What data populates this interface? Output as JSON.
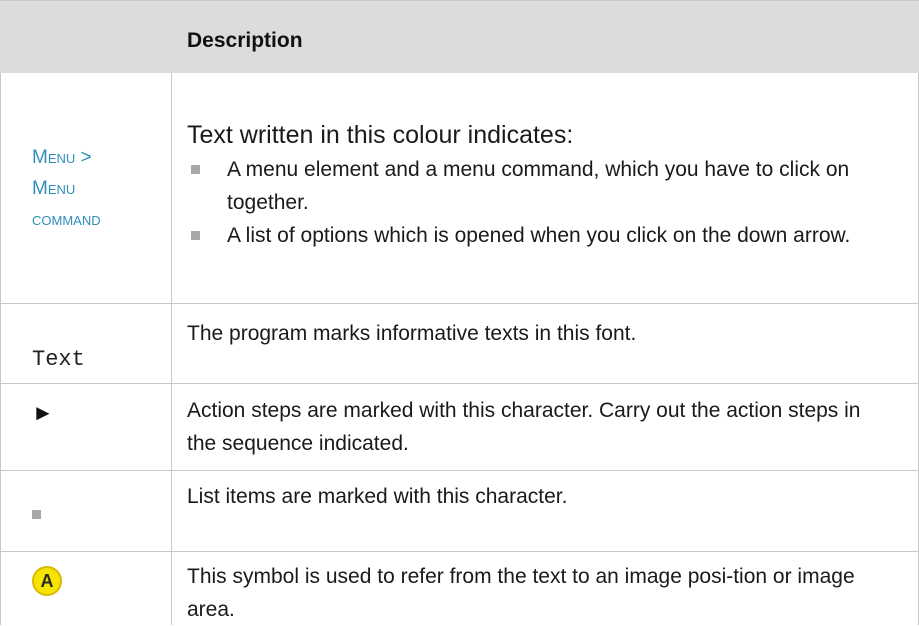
{
  "header": {
    "title": "Description"
  },
  "rows": [
    {
      "left": {
        "menu_line1": "Menu >",
        "menu_line2": "Menu",
        "menu_line3": "command"
      },
      "right": {
        "intro": "Text written in this colour indicates:",
        "bullets": [
          "A menu element and a menu command, which you have to click on together.",
          "A list of options which is opened when you click on the down arrow."
        ]
      }
    },
    {
      "left": {
        "text": "Text"
      },
      "right": {
        "text": "The program marks informative texts in this font."
      }
    },
    {
      "left": {
        "symbol": "►"
      },
      "right": {
        "text": "Action steps are marked with this character. Carry out the action steps in the sequence indicated."
      }
    },
    {
      "left": {
        "symbol": "list-square-bullet"
      },
      "right": {
        "text": "List items are marked with this character."
      }
    },
    {
      "left": {
        "symbol": "A"
      },
      "right": {
        "text": "This symbol is used to refer from the text to an image posi-tion or image area."
      }
    }
  ],
  "colors": {
    "menu_text": "#2f8fb8",
    "header_bg": "#dcdcdc",
    "badge": "#f7e400"
  }
}
